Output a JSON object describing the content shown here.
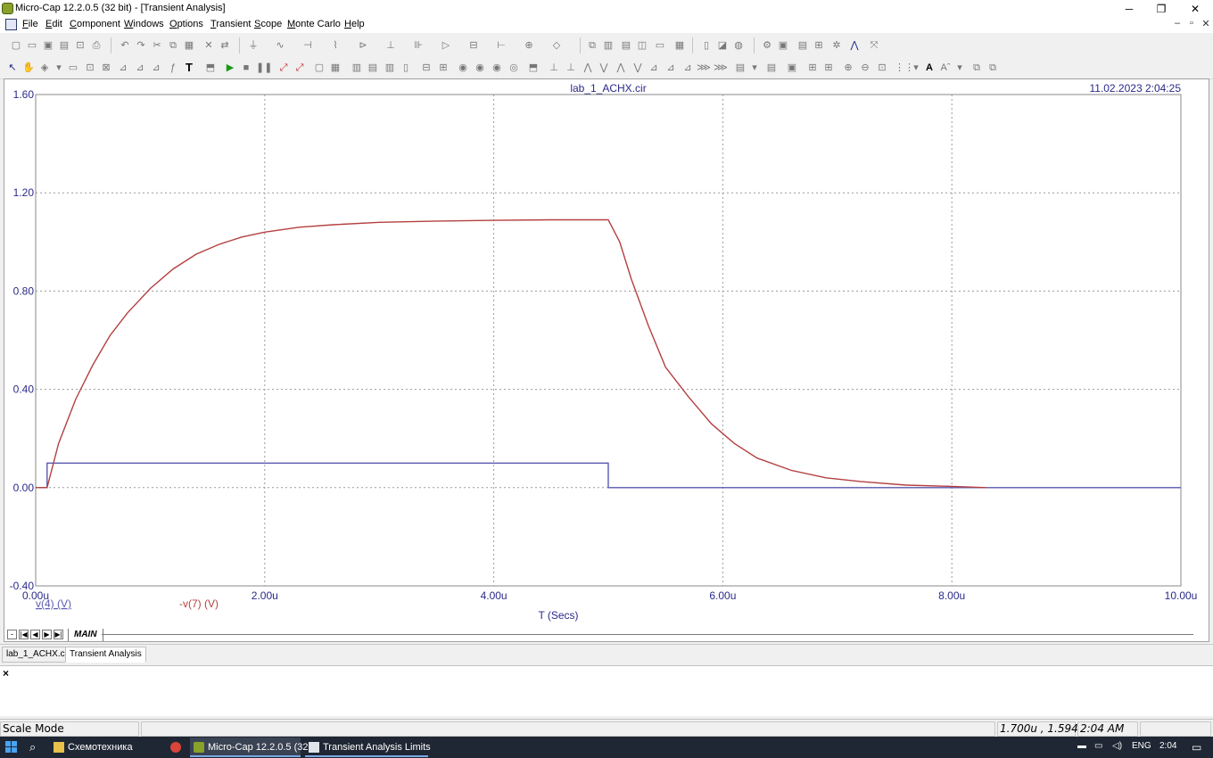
{
  "window": {
    "title": "Micro-Cap 12.2.0.5 (32 bit) - [Transient Analysis]",
    "controls": {
      "minimize": "─",
      "restore": "❐",
      "close": "✕"
    },
    "mdi_controls": {
      "minimize": "–",
      "restore": "▫",
      "close": "✕"
    }
  },
  "menu": [
    {
      "key": "F",
      "rest": "ile"
    },
    {
      "key": "E",
      "rest": "dit"
    },
    {
      "key": "C",
      "rest": "omponent"
    },
    {
      "key": "W",
      "rest": "indows"
    },
    {
      "key": "O",
      "rest": "ptions"
    },
    {
      "key": "T",
      "rest": "ransient"
    },
    {
      "key": "S",
      "rest": "cope"
    },
    {
      "key": "M",
      "rest": "onte Carlo"
    },
    {
      "key": "H",
      "rest": "elp"
    }
  ],
  "plot": {
    "file_title": "lab_1_ACHX.cir",
    "timestamp": "11.02.2023 2:04:25",
    "x_axis_label": "T (Secs)",
    "legend": [
      {
        "label": "v(4) (V)",
        "color": "#5a5ab0"
      },
      {
        "label": "-v(7) (V)",
        "color": "#b44040"
      }
    ],
    "sheet_tab": "MAIN"
  },
  "chart_data": {
    "type": "line",
    "title": "lab_1_ACHX.cir",
    "xlabel": "T (Secs)",
    "ylabel": "",
    "xlim": [
      0,
      10
    ],
    "ylim": [
      -0.4,
      1.6
    ],
    "x_ticks": [
      "0.00u",
      "2.00u",
      "4.00u",
      "6.00u",
      "8.00u",
      "10.00u"
    ],
    "y_ticks": [
      "-0.40",
      "0.00",
      "0.40",
      "0.80",
      "1.20",
      "1.60"
    ],
    "grid": true,
    "series": [
      {
        "name": "v(4) (V)",
        "color": "#5a5ab0",
        "x": [
          0,
          0.1,
          0.1,
          5.0,
          5.0,
          10.0
        ],
        "y": [
          0,
          0,
          0.1,
          0.1,
          0,
          0
        ]
      },
      {
        "name": "-v(7) (V)",
        "color": "#b44040",
        "x": [
          0,
          0.1,
          0.2,
          0.35,
          0.5,
          0.65,
          0.8,
          1.0,
          1.2,
          1.4,
          1.6,
          1.8,
          2.0,
          2.3,
          2.6,
          3.0,
          3.5,
          4.0,
          4.5,
          5.0,
          5.1,
          5.2,
          5.35,
          5.5,
          5.7,
          5.9,
          6.1,
          6.3,
          6.6,
          6.9,
          7.2,
          7.6,
          8.0,
          8.3
        ],
        "y": [
          0,
          0.0,
          0.18,
          0.36,
          0.5,
          0.62,
          0.71,
          0.81,
          0.89,
          0.95,
          0.99,
          1.02,
          1.04,
          1.06,
          1.07,
          1.08,
          1.085,
          1.088,
          1.09,
          1.09,
          1.0,
          0.85,
          0.66,
          0.49,
          0.37,
          0.26,
          0.18,
          0.12,
          0.07,
          0.04,
          0.025,
          0.01,
          0.005,
          0.0
        ]
      }
    ]
  },
  "tabs": [
    {
      "label": "lab_1_ACHX.cir"
    },
    {
      "label": "Transient Analysis"
    }
  ],
  "message_pane": {
    "close": "×"
  },
  "status": {
    "mode": "Scale Mode",
    "coords": "1.700u , 1.594",
    "time": "2:04 AM"
  },
  "taskbar": {
    "items": [
      {
        "label": "Схемотехника"
      },
      {
        "label": "Micro-Cap 12.2.0.5 (32..."
      },
      {
        "label": "Transient Analysis Limits"
      }
    ],
    "lang": "ENG",
    "clock": "2:04"
  }
}
